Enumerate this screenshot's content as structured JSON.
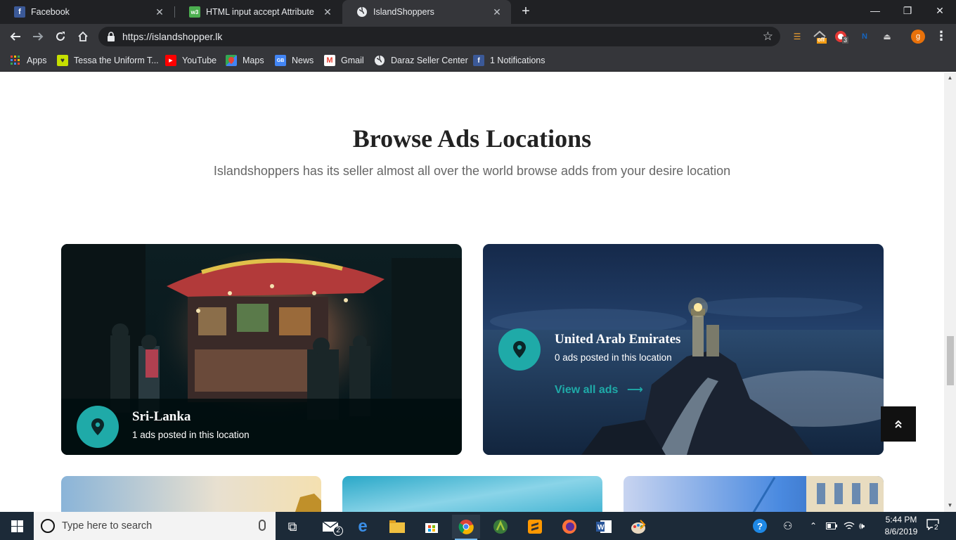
{
  "browser": {
    "tabs": [
      {
        "title": "Facebook",
        "active": false
      },
      {
        "title": "HTML input accept Attribute",
        "active": false
      },
      {
        "title": "IslandShoppers",
        "active": true
      }
    ],
    "url": "https://islandshopper.lk",
    "bookmarks": [
      {
        "label": "Apps"
      },
      {
        "label": "Tessa the Uniform T..."
      },
      {
        "label": "YouTube"
      },
      {
        "label": "Maps"
      },
      {
        "label": "News"
      },
      {
        "label": "Gmail"
      },
      {
        "label": "Daraz Seller Center"
      },
      {
        "label": "1 Notifications"
      }
    ],
    "extensions": {
      "off_badge": "off",
      "count_badge": "3",
      "profile_initial": "g"
    }
  },
  "page": {
    "title": "Browse Ads Locations",
    "subtitle": "Islandshoppers has its seller almost all over the world browse adds from your desire location",
    "locations": [
      {
        "name": "Sri-Lanka",
        "count_text": "1 ads posted in this location"
      },
      {
        "name": "United Arab Emirates",
        "count_text": "0 ads posted in this location",
        "link": "View all ads"
      }
    ],
    "back_to_top_icon": "double-chevron-up-icon",
    "colors": {
      "accent": "#1faaa8",
      "title": "#222222"
    }
  },
  "taskbar": {
    "search_placeholder": "Type here to search",
    "mail_badge": "2",
    "time": "5:44 PM",
    "date": "8/6/2019",
    "notifications": "2"
  }
}
